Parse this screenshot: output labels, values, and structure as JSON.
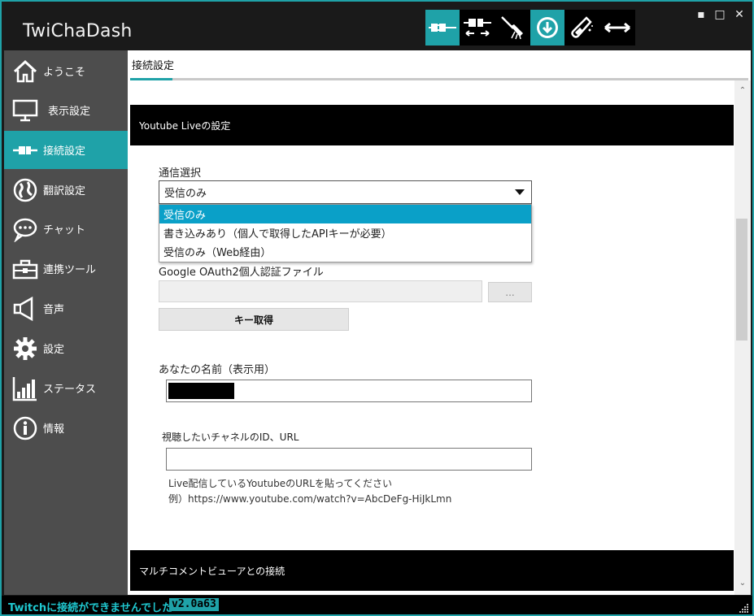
{
  "app": {
    "title": "TwiChaDash"
  },
  "window_controls": {
    "minimize": "▪",
    "maximize": "□",
    "close": "✕"
  },
  "toolbar": {
    "buttons": [
      {
        "icon": "connect-icon",
        "active": true
      },
      {
        "icon": "connect-arrows-icon",
        "active": false
      },
      {
        "icon": "broom-icon",
        "active": false
      },
      {
        "icon": "download-icon",
        "active": true
      },
      {
        "icon": "test-tube-icon",
        "active": false
      },
      {
        "icon": "resize-horizontal-icon",
        "active": false
      }
    ]
  },
  "sidebar": {
    "items": [
      {
        "label": "ようこそ",
        "icon": "home-icon"
      },
      {
        "label": "表示設定",
        "icon": "monitor-icon"
      },
      {
        "label": "接続設定",
        "icon": "plug-icon",
        "active": true
      },
      {
        "label": "翻訳設定",
        "icon": "globe-icon"
      },
      {
        "label": "チャット",
        "icon": "chat-bubble-icon"
      },
      {
        "label": "連携ツール",
        "icon": "toolbox-icon"
      },
      {
        "label": "音声",
        "icon": "speaker-icon"
      },
      {
        "label": "設定",
        "icon": "gear-icon"
      },
      {
        "label": "ステータス",
        "icon": "bar-chart-icon"
      },
      {
        "label": "情報",
        "icon": "info-icon"
      }
    ]
  },
  "main": {
    "tab": "接続設定",
    "youtube_section": {
      "title": "Youtube Liveの設定",
      "comm_label": "通信選択",
      "comm_selected": "受信のみ",
      "comm_options": [
        "受信のみ",
        "書き込みあり（個人で取得したAPIキーが必要）",
        "受信のみ（Web経由）"
      ],
      "oauth_label": "Google OAuth2個人認証ファイル",
      "browse_label": "...",
      "key_button": "キー取得",
      "name_label": "あなたの名前（表示用）",
      "channel_label": "視聴したいチャネルのID、URL",
      "hint_line1": "Live配信しているYoutubeのURLを貼ってください",
      "hint_line2": "例）https://www.youtube.com/watch?v=AbcDeFg-HiJkLmn"
    },
    "multi_section": {
      "title": "マルチコメントビューアとの接続"
    }
  },
  "status": {
    "message": "Twitchに接続ができませんでした",
    "version": "v2.0a63"
  },
  "colors": {
    "accent": "#1fa2a8",
    "sidebar": "#4d4d4d",
    "selection": "#0aa0c8"
  }
}
